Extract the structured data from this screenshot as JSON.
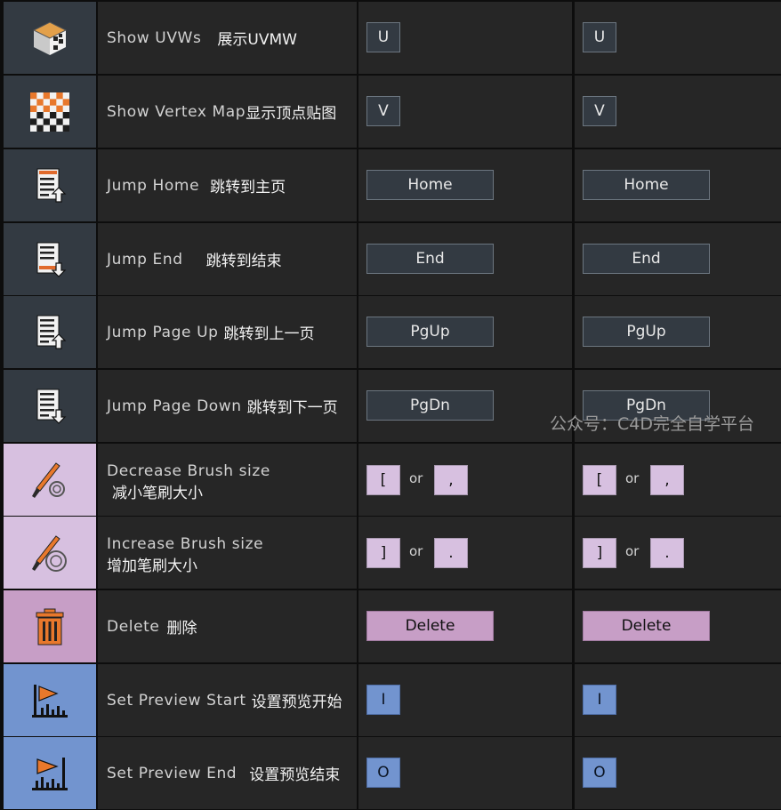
{
  "colors": {
    "icon_bg_gray": "#333a42",
    "icon_bg_pink": "#d7c0e0",
    "icon_bg_magenta": "#c79ec6",
    "icon_bg_blue": "#7294cf",
    "cell_bg": "#262626",
    "border": "#0d0d0d"
  },
  "or_text": "or",
  "watermark": "公众号：C4D完全自学平台",
  "rows": [
    {
      "icon": "uvw-cube-icon",
      "en": "Show UVWs",
      "zh": "展示UVMW",
      "key1": "U",
      "key2": "U"
    },
    {
      "icon": "checkerboard-icon",
      "en": "Show Vertex Map",
      "zh": "显示顶点贴图",
      "key1": "V",
      "key2": "V"
    },
    {
      "icon": "jump-home-icon",
      "en": "Jump Home",
      "zh": "跳转到主页",
      "key1": "Home",
      "key2": "Home"
    },
    {
      "icon": "jump-end-icon",
      "en": "Jump End",
      "zh": "跳转到结束",
      "key1": "End",
      "key2": "End"
    },
    {
      "icon": "page-up-icon",
      "en": "Jump Page Up",
      "zh": "跳转到上一页",
      "key1": "PgUp",
      "key2": "PgUp"
    },
    {
      "icon": "page-down-icon",
      "en": "Jump Page Down",
      "zh": "跳转到下一页",
      "key1": "PgDn",
      "key2": "PgDn"
    },
    {
      "icon": "brush-decrease-icon",
      "en": "Decrease Brush size",
      "zh": "减小笔刷大小",
      "key1a": "[",
      "key1b": ",",
      "key2a": "[",
      "key2b": ","
    },
    {
      "icon": "brush-increase-icon",
      "en": "Increase Brush size",
      "zh": "增加笔刷大小",
      "key1a": "]",
      "key1b": ".",
      "key2a": "]",
      "key2b": "."
    },
    {
      "icon": "trash-icon",
      "en": "Delete",
      "zh": "删除",
      "key1": "Delete",
      "key2": "Delete"
    },
    {
      "icon": "preview-start-icon",
      "en": "Set Preview Start",
      "zh": "设置预览开始",
      "key1": "I",
      "key2": "I"
    },
    {
      "icon": "preview-end-icon",
      "en": "Set Preview End",
      "zh": "设置预览结束",
      "key1": "O",
      "key2": "O"
    }
  ]
}
